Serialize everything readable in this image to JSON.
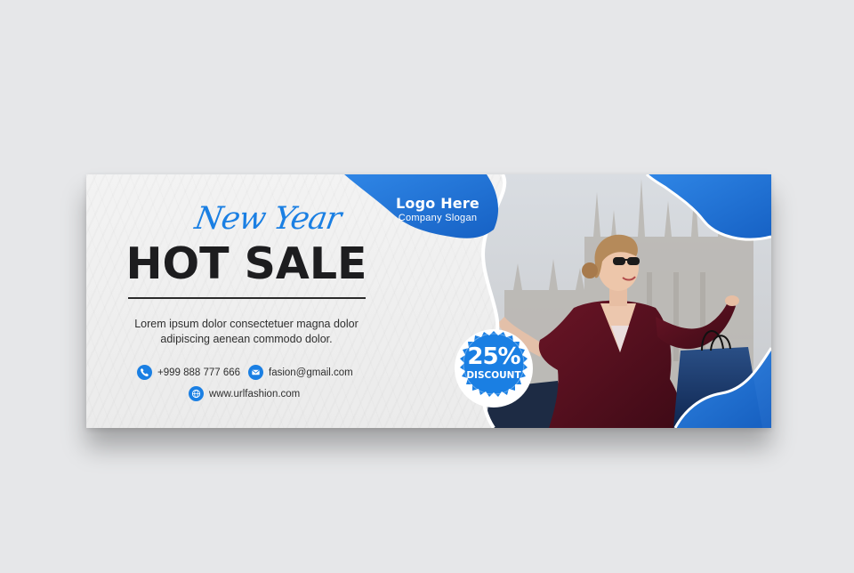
{
  "banner": {
    "script_title": "New Year",
    "main_title": "HOT SALE",
    "body_text": "Lorem ipsum dolor consectetuer magna dolor adipiscing aenean commodo dolor."
  },
  "logo": {
    "title": "Logo Here",
    "slogan": "Company Slogan"
  },
  "badge": {
    "percent": "25%",
    "label": "DISCOUNT"
  },
  "contacts": {
    "phone": "+999 888 777 666",
    "email": "fasion@gmail.com",
    "website": "www.urlfashion.com"
  },
  "icons": {
    "phone": "phone-icon",
    "email": "envelope-icon",
    "website": "globe-icon"
  },
  "colors": {
    "accent": "#1a7fe3",
    "dark_text": "#1d1d1f",
    "background": "#e6e7e9",
    "dress": "#5a1220"
  }
}
